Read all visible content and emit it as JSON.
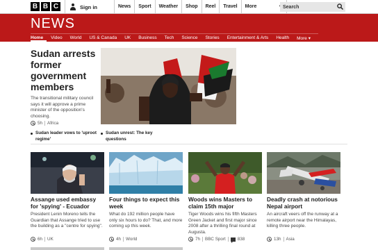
{
  "topbar": {
    "logo": [
      "B",
      "B",
      "C"
    ],
    "signin_label": "Sign in",
    "nav": [
      "News",
      "Sport",
      "Weather",
      "Shop",
      "Reel",
      "Travel"
    ],
    "more_label": "More",
    "search_placeholder": "Search"
  },
  "section": {
    "title": "NEWS",
    "nav": [
      "Home",
      "Video",
      "World",
      "US & Canada",
      "UK",
      "Business",
      "Tech",
      "Science",
      "Stories",
      "Entertainment & Arts",
      "Health"
    ],
    "more_label": "More ▾",
    "active_item": "Home",
    "brand_color": "#bb1919"
  },
  "lead": {
    "headline": "Sudan arrests former government members",
    "summary": "The transitional military council says it will approve a prime minister of the opposition's choosing.",
    "time": "5h",
    "tag": "Africa",
    "related": [
      "Sudan leader vows to 'uproot regime'",
      "Sudan unrest: The key questions"
    ]
  },
  "stories": [
    {
      "headline": "Assange used embassy for 'spying' - Ecuador",
      "summary": "President Lenin Moreno tells the Guardian that Assange tried to use the building as a \"centre for spying\".",
      "time": "6h",
      "tag": "UK",
      "comments": ""
    },
    {
      "headline": "Four things to expect this week",
      "summary": "What do 192 million people have only six hours to do? That, and more coming up this week.",
      "time": "4h",
      "tag": "World",
      "comments": ""
    },
    {
      "headline": "Woods wins Masters to claim 15th major",
      "summary": "Tiger Woods wins his fifth Masters Green Jacket and first major since 2008 after a thrilling final round at Augusta.",
      "time": "7h",
      "tag": "BBC Sport",
      "comments": "838"
    },
    {
      "headline": "Deadly crash at notorious Nepal airport",
      "summary": "An aircraft veers off the runway at a remote airport near the Himalayas, killing three people.",
      "time": "13h",
      "tag": "Asia",
      "comments": ""
    }
  ]
}
